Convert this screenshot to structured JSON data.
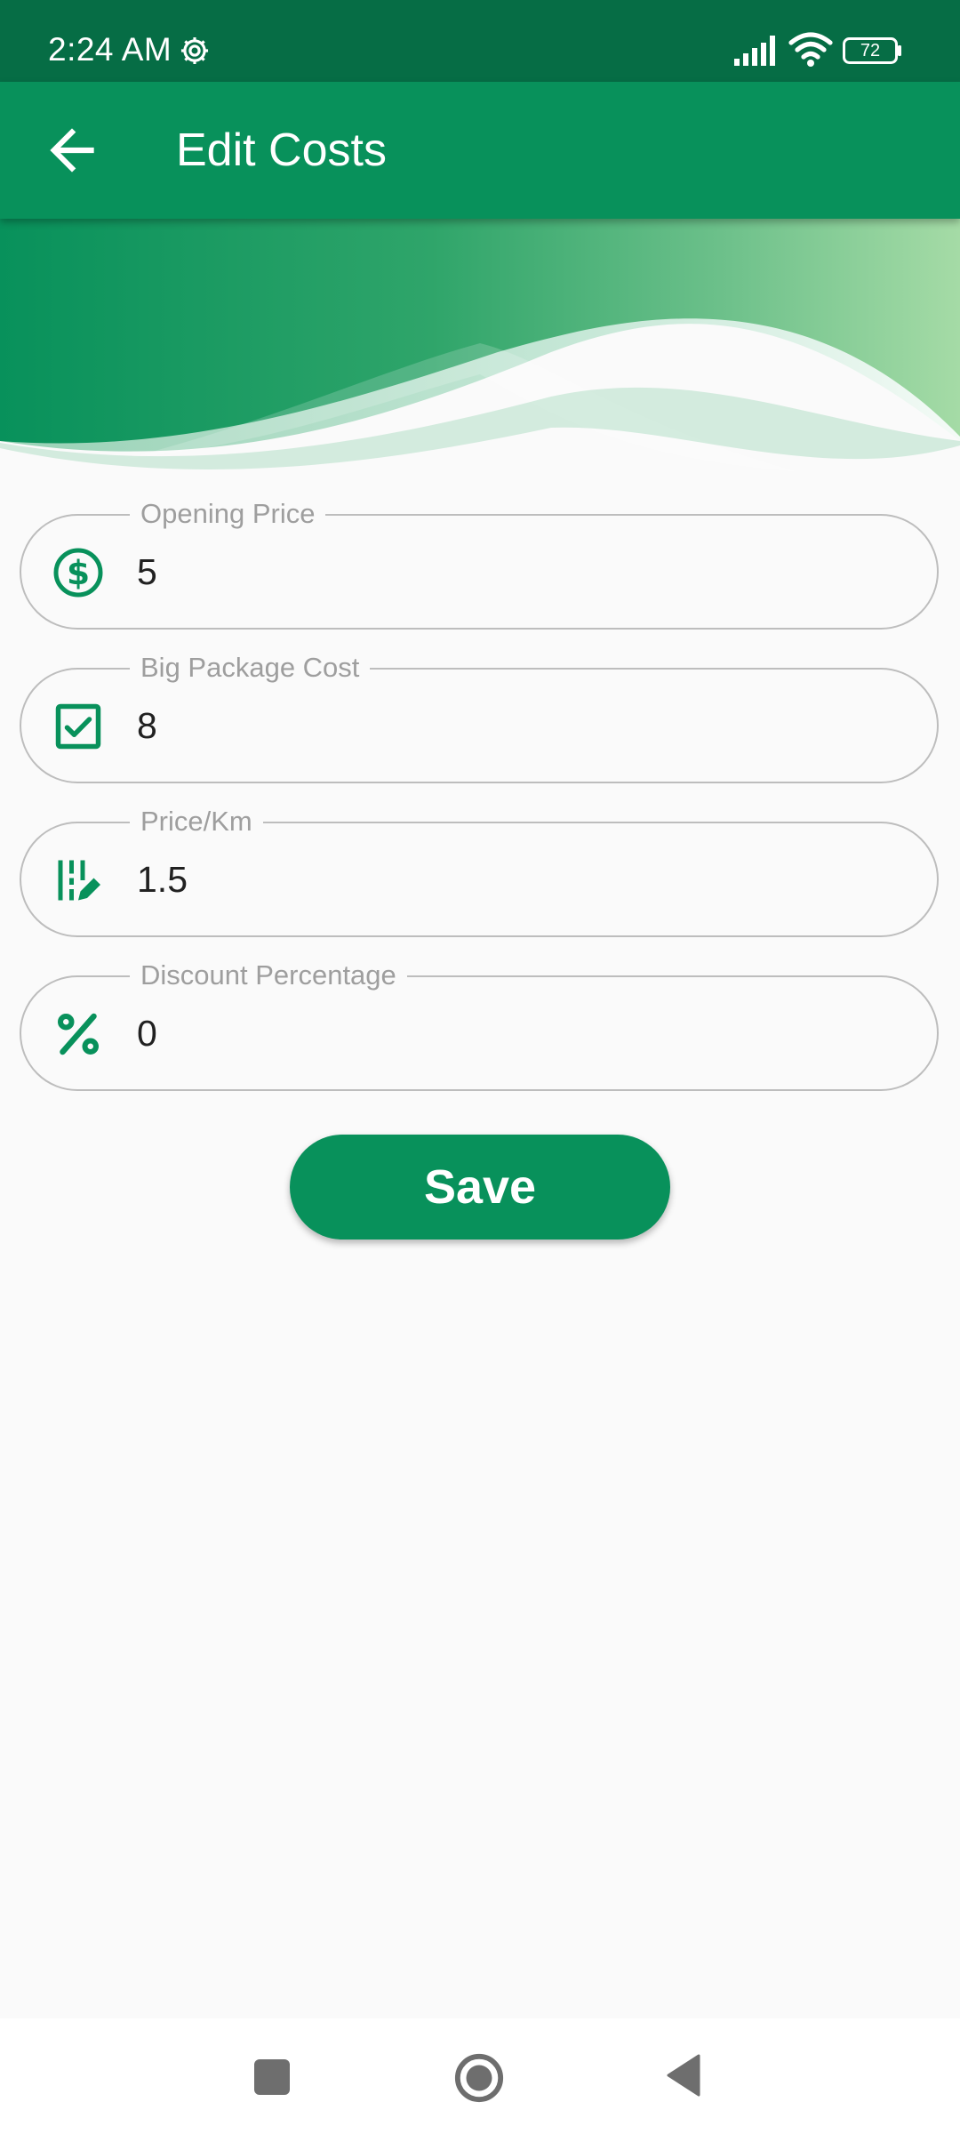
{
  "status_bar": {
    "time": "2:24 AM",
    "battery": "72",
    "icons": [
      "settings-gear-icon",
      "cell-signal-icon",
      "wifi-icon",
      "battery-icon"
    ]
  },
  "app_bar": {
    "title": "Edit Costs",
    "back_icon": "arrow-left-icon"
  },
  "fields": [
    {
      "label": "Opening Price",
      "value": "5",
      "icon": "dollar-circle-icon"
    },
    {
      "label": "Big Package Cost",
      "value": "8",
      "icon": "checkbox-checked-icon"
    },
    {
      "label": "Price/Km",
      "value": "1.5",
      "icon": "ruler-edit-icon"
    },
    {
      "label": "Discount Percentage",
      "value": "0",
      "icon": "percent-icon"
    }
  ],
  "save_label": "Save",
  "colors": {
    "primary": "#08915B",
    "status_bar": "#066D45",
    "background": "#FAFAFA",
    "field_border": "#BDBDBD",
    "label": "#9E9E9E"
  },
  "nav_bar": {
    "icons": [
      "recents-square-icon",
      "home-circle-icon",
      "back-triangle-icon"
    ]
  }
}
